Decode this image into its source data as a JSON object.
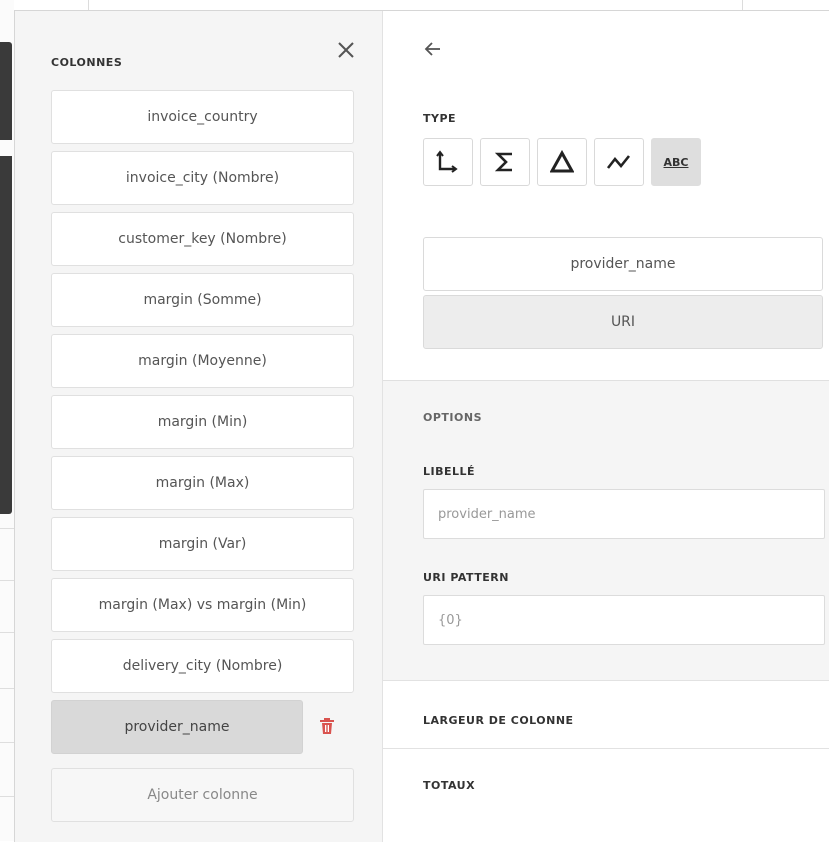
{
  "left_panel": {
    "title": "COLONNES",
    "columns": [
      {
        "label": "invoice_country"
      },
      {
        "label": "invoice_city (Nombre)"
      },
      {
        "label": "customer_key (Nombre)"
      },
      {
        "label": "margin (Somme)"
      },
      {
        "label": "margin (Moyenne)"
      },
      {
        "label": "margin (Min)"
      },
      {
        "label": "margin (Max)"
      },
      {
        "label": "margin (Var)"
      },
      {
        "label": "margin (Max) vs margin (Min)"
      },
      {
        "label": "delivery_city (Nombre)"
      }
    ],
    "active_column": {
      "label": "provider_name"
    },
    "add_column_label": "Ajouter colonne",
    "icons": {
      "close": "close-icon",
      "delete": "trash-icon"
    },
    "delete_color": "#d9534f"
  },
  "right_panel": {
    "type_label": "TYPE",
    "type_buttons": [
      {
        "icon": "dimension-icon"
      },
      {
        "icon": "sum-icon"
      },
      {
        "icon": "delta-icon"
      },
      {
        "icon": "trend-icon"
      },
      {
        "icon": "abc-icon",
        "text": "ABC",
        "active": true
      }
    ],
    "field_name": "provider_name",
    "field_type": "URI",
    "options": {
      "title": "OPTIONS",
      "libelle_label": "LIBELLÉ",
      "libelle_placeholder": "provider_name",
      "uri_pattern_label": "URI PATTERN",
      "uri_pattern_placeholder": "{0}"
    },
    "sections": {
      "largeur": "LARGEUR DE COLONNE",
      "totaux": "TOTAUX"
    }
  }
}
